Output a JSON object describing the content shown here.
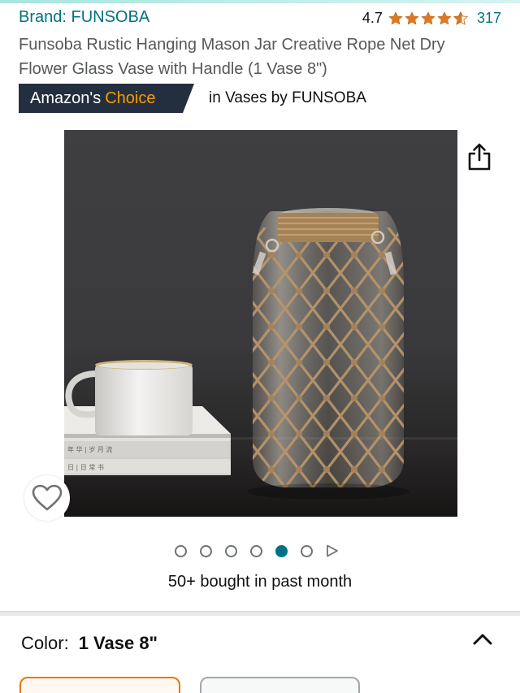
{
  "header": {
    "brand": "Brand: FUNSOBA",
    "rating_value": "4.7",
    "rating_stars": 4.7,
    "rating_count": "317"
  },
  "product": {
    "title": "Funsoba Rustic Hanging Mason Jar Creative Rope Net Dry Flower Glass Vase with Handle (1 Vase 8\")"
  },
  "badge": {
    "prefix": "Amazon's",
    "choice": "Choice",
    "category": "in Vases by FUNSOBA"
  },
  "gallery": {
    "image_count": 6,
    "active_index": 4,
    "has_video": true,
    "book_text_1": "年 华 | 岁 月 流",
    "book_text_2": "日 | 日 常 书"
  },
  "social_proof": {
    "bought": "50+ bought in past month"
  },
  "variation": {
    "label": "Color:",
    "value": "1 Vase 8\""
  },
  "icons": {
    "share": "share-icon",
    "wishlist": "heart-icon",
    "collapse": "chevron-up-icon",
    "video": "play-icon"
  },
  "colors": {
    "link": "#007185",
    "star": "#de7921",
    "badge_bg": "#232f3e",
    "badge_choice": "#ff9900",
    "selected_border": "#e77600"
  }
}
